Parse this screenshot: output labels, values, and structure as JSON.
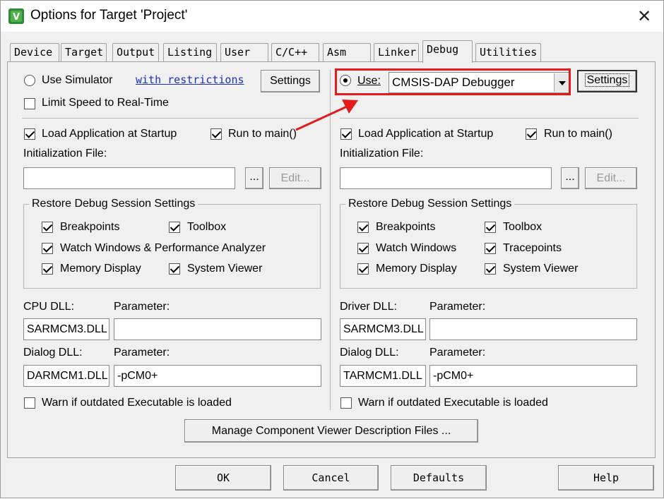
{
  "window": {
    "title": "Options for Target 'Project'",
    "close_glyph": "✕",
    "app_icon": "keil-uvision-icon"
  },
  "tabs": [
    {
      "label": "Device"
    },
    {
      "label": "Target"
    },
    {
      "label": "Output"
    },
    {
      "label": "Listing"
    },
    {
      "label": "User"
    },
    {
      "label": "C/C++"
    },
    {
      "label": "Asm"
    },
    {
      "label": "Linker"
    },
    {
      "label": "Debug",
      "active": true
    },
    {
      "label": "Utilities"
    }
  ],
  "left": {
    "use_simulator": "Use Simulator",
    "with_restrictions": "with restrictions",
    "settings": "Settings",
    "limit_speed": "Limit Speed to Real-Time",
    "load_app": "Load Application at Startup",
    "run_to_main": "Run to main()",
    "init_file_label": "Initialization File:",
    "init_file_value": "",
    "browse": "...",
    "edit": "Edit...",
    "restore_title": "Restore Debug Session Settings",
    "restore": {
      "breakpoints": "Breakpoints",
      "toolbox": "Toolbox",
      "watch": "Watch Windows & Performance Analyzer",
      "memory": "Memory Display",
      "system_viewer": "System Viewer"
    },
    "cpu_dll_label": "CPU DLL:",
    "cpu_dll_value": "SARMCM3.DLL",
    "param_label": "Parameter:",
    "cpu_param_value": "",
    "dialog_dll_label": "Dialog DLL:",
    "dialog_dll_value": "DARMCM1.DLL",
    "dialog_param_label": "Parameter:",
    "dialog_param_value": "-pCM0+",
    "warn": "Warn if outdated Executable is loaded"
  },
  "right": {
    "use": "Use:",
    "debugger": "CMSIS-DAP Debugger",
    "settings": "Settings",
    "load_app": "Load Application at Startup",
    "run_to_main": "Run to main()",
    "init_file_label": "Initialization File:",
    "init_file_value": "",
    "browse": "...",
    "edit": "Edit...",
    "restore_title": "Restore Debug Session Settings",
    "restore": {
      "breakpoints": "Breakpoints",
      "toolbox": "Toolbox",
      "watch": "Watch Windows",
      "tracepoints": "Tracepoints",
      "memory": "Memory Display",
      "system_viewer": "System Viewer"
    },
    "driver_dll_label": "Driver DLL:",
    "driver_dll_value": "SARMCM3.DLL",
    "param_label": "Parameter:",
    "driver_param_value": "",
    "dialog_dll_label": "Dialog DLL:",
    "dialog_dll_value": "TARMCM1.DLL",
    "dialog_param_label": "Parameter:",
    "dialog_param_value": "-pCM0+",
    "warn": "Warn if outdated Executable is loaded"
  },
  "manage_button": "Manage Component Viewer Description Files ...",
  "footer": {
    "ok": "OK",
    "cancel": "Cancel",
    "defaults": "Defaults",
    "help": "Help"
  },
  "colors": {
    "highlight": "#e41b1b",
    "link": "#1b2fc4",
    "dialog_bg": "#f0f0f0"
  }
}
